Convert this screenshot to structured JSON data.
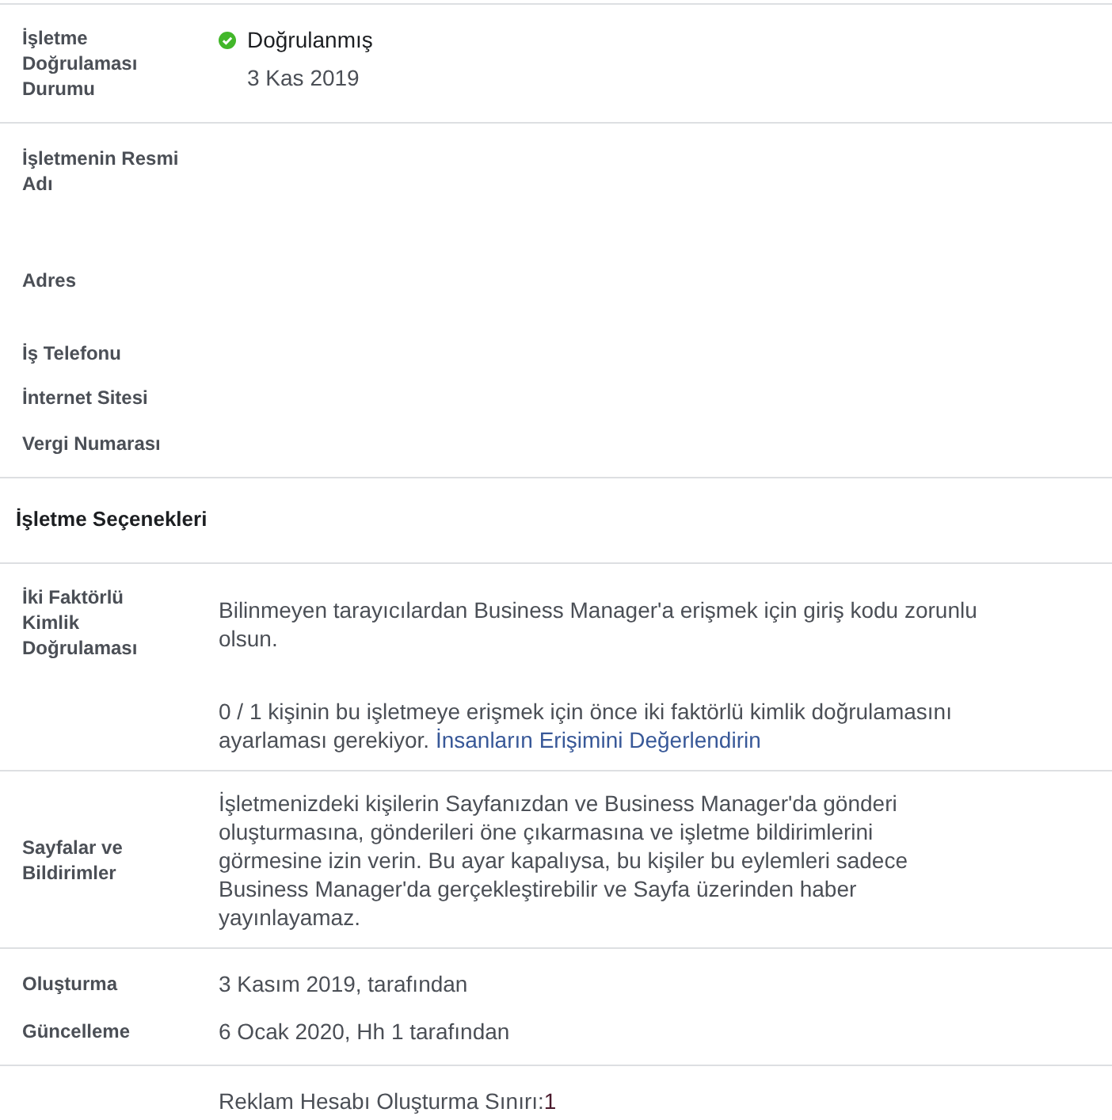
{
  "sections": [
    {
      "kind": "verification",
      "label": "İşletme Doğrulaması Durumu",
      "verified": true,
      "status": "Doğrulanmış",
      "date": "3 Kas 2019"
    },
    {
      "kind": "info",
      "fields": [
        {
          "label": "İşletmenin Resmi Adı"
        },
        {
          "label": "Adres"
        },
        {
          "label": "İş Telefonu"
        },
        {
          "label": "İnternet Sitesi"
        },
        {
          "label": "Vergi Numarası"
        }
      ]
    },
    {
      "kind": "heading",
      "title": "İşletme Seçenekleri"
    },
    {
      "kind": "two_factor",
      "label": "İki Faktörlü Kimlik Doğrulaması",
      "description": "Bilinmeyen tarayıcılardan Business Manager'a erişmek için giriş kodu zorunlu olsun.",
      "note": "0 / 1 kişinin bu işletmeye erişmek için önce iki faktörlü kimlik doğrulamasını ayarlaması gerekiyor.",
      "link": "İnsanların Erişimini Değerlendirin"
    },
    {
      "kind": "pages",
      "label": "Sayfalar ve Bildirimler",
      "description": "İşletmenizdeki kişilerin Sayfanızdan ve Business Manager'da gönderi oluşturmasına, gönderileri öne çıkarmasına ve işletme bildirimlerini görmesine izin verin. Bu ayar kapalıysa, bu kişiler bu eylemleri sadece Business Manager'da gerçekleştirebilir ve Sayfa üzerinden haber yayınlayamaz."
    },
    {
      "kind": "history",
      "rows": [
        {
          "label": "Oluşturma",
          "value": "3 Kasım 2019, tarafından"
        },
        {
          "label": "Güncelleme",
          "value": "6 Ocak 2020, Hh 1 tarafından"
        }
      ]
    },
    {
      "kind": "limit",
      "label": "Reklam Hesabı Oluşturma Sınırı:",
      "value": "1"
    }
  ]
}
